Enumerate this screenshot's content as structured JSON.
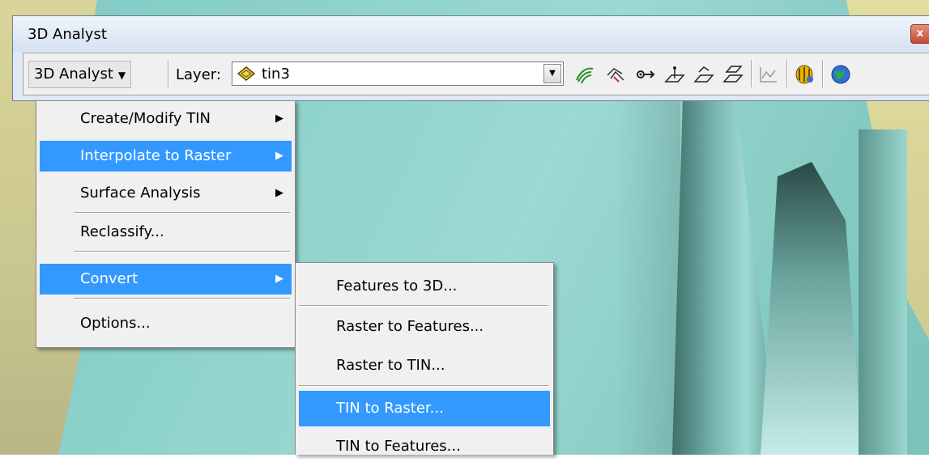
{
  "window": {
    "title": "3D Analyst",
    "close": "x"
  },
  "toolbar": {
    "menu_label": "3D Analyst",
    "menu_arrow": "▼",
    "layer_label": "Layer:",
    "layer_value": "tin3",
    "tools": [
      "contour-icon",
      "steepest-path-icon",
      "line-of-sight-icon",
      "interpolate-point-icon",
      "interpolate-line-icon",
      "interpolate-polygon-icon",
      "profile-graph-icon",
      "arcscene-icon",
      "arcglobe-icon"
    ]
  },
  "menu": {
    "items": [
      {
        "label": "Create/Modify TIN",
        "submenu": true
      },
      {
        "label": "Interpolate to Raster",
        "submenu": true,
        "highlighted": true
      },
      {
        "label": "Surface Analysis",
        "submenu": true
      },
      {
        "label": "Reclassify..."
      },
      {
        "label": "Convert",
        "submenu": true,
        "highlighted": true
      },
      {
        "label": "Options..."
      }
    ]
  },
  "convert_submenu": {
    "items": [
      {
        "label": "Features to 3D..."
      },
      {
        "label": "Raster to Features..."
      },
      {
        "label": "Raster to TIN..."
      },
      {
        "label": "TIN to Raster...",
        "highlighted": true
      },
      {
        "label": "TIN to Features..."
      }
    ]
  },
  "colors": {
    "highlight": "#3399ff",
    "menu_bg": "#f0f0f0",
    "titlebar": "#dfe8f4"
  }
}
